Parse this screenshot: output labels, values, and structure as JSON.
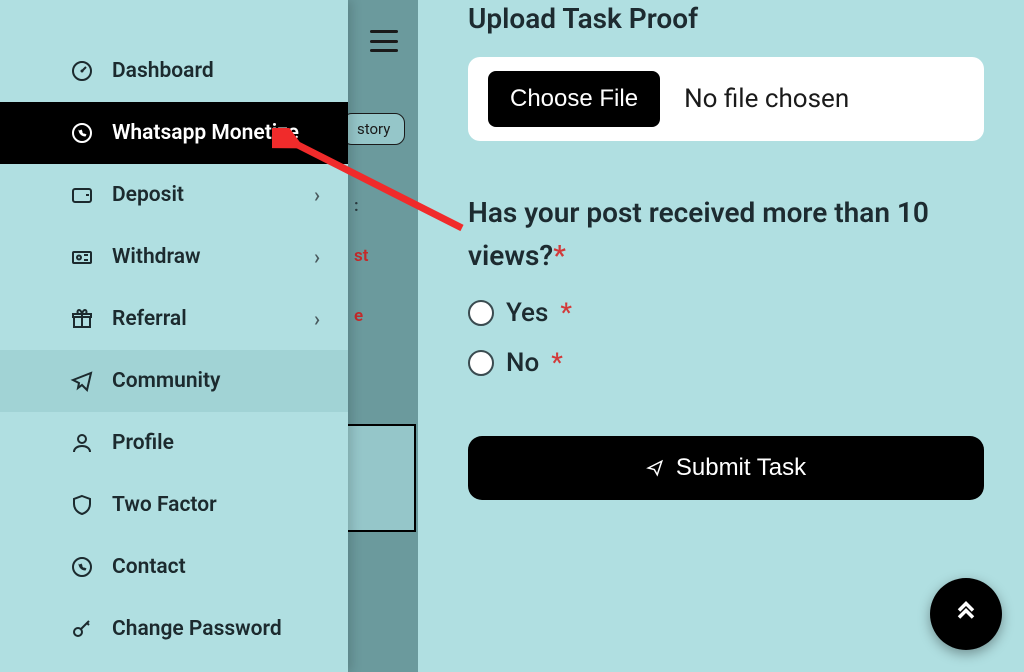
{
  "sidebar": {
    "items": [
      {
        "label": "Dashboard",
        "chevron": false
      },
      {
        "label": "Whatsapp Monetize",
        "chevron": false
      },
      {
        "label": "Deposit",
        "chevron": true
      },
      {
        "label": "Withdraw",
        "chevron": true
      },
      {
        "label": "Referral",
        "chevron": true
      },
      {
        "label": "Community",
        "chevron": false
      },
      {
        "label": "Profile",
        "chevron": false
      },
      {
        "label": "Two Factor",
        "chevron": false
      },
      {
        "label": "Contact",
        "chevron": false
      },
      {
        "label": "Change Password",
        "chevron": false
      }
    ]
  },
  "mid": {
    "history_label": "story",
    "peek_colon": ":",
    "peek_st": "st",
    "peek_e": "e"
  },
  "form": {
    "upload_title": "Upload Task Proof",
    "choose_label": "Choose File",
    "no_file": "No file chosen",
    "question": "Has your post received more than 10 views?",
    "asterisk": "*",
    "option_yes": "Yes",
    "option_no": "No",
    "submit_label": "Submit Task"
  }
}
